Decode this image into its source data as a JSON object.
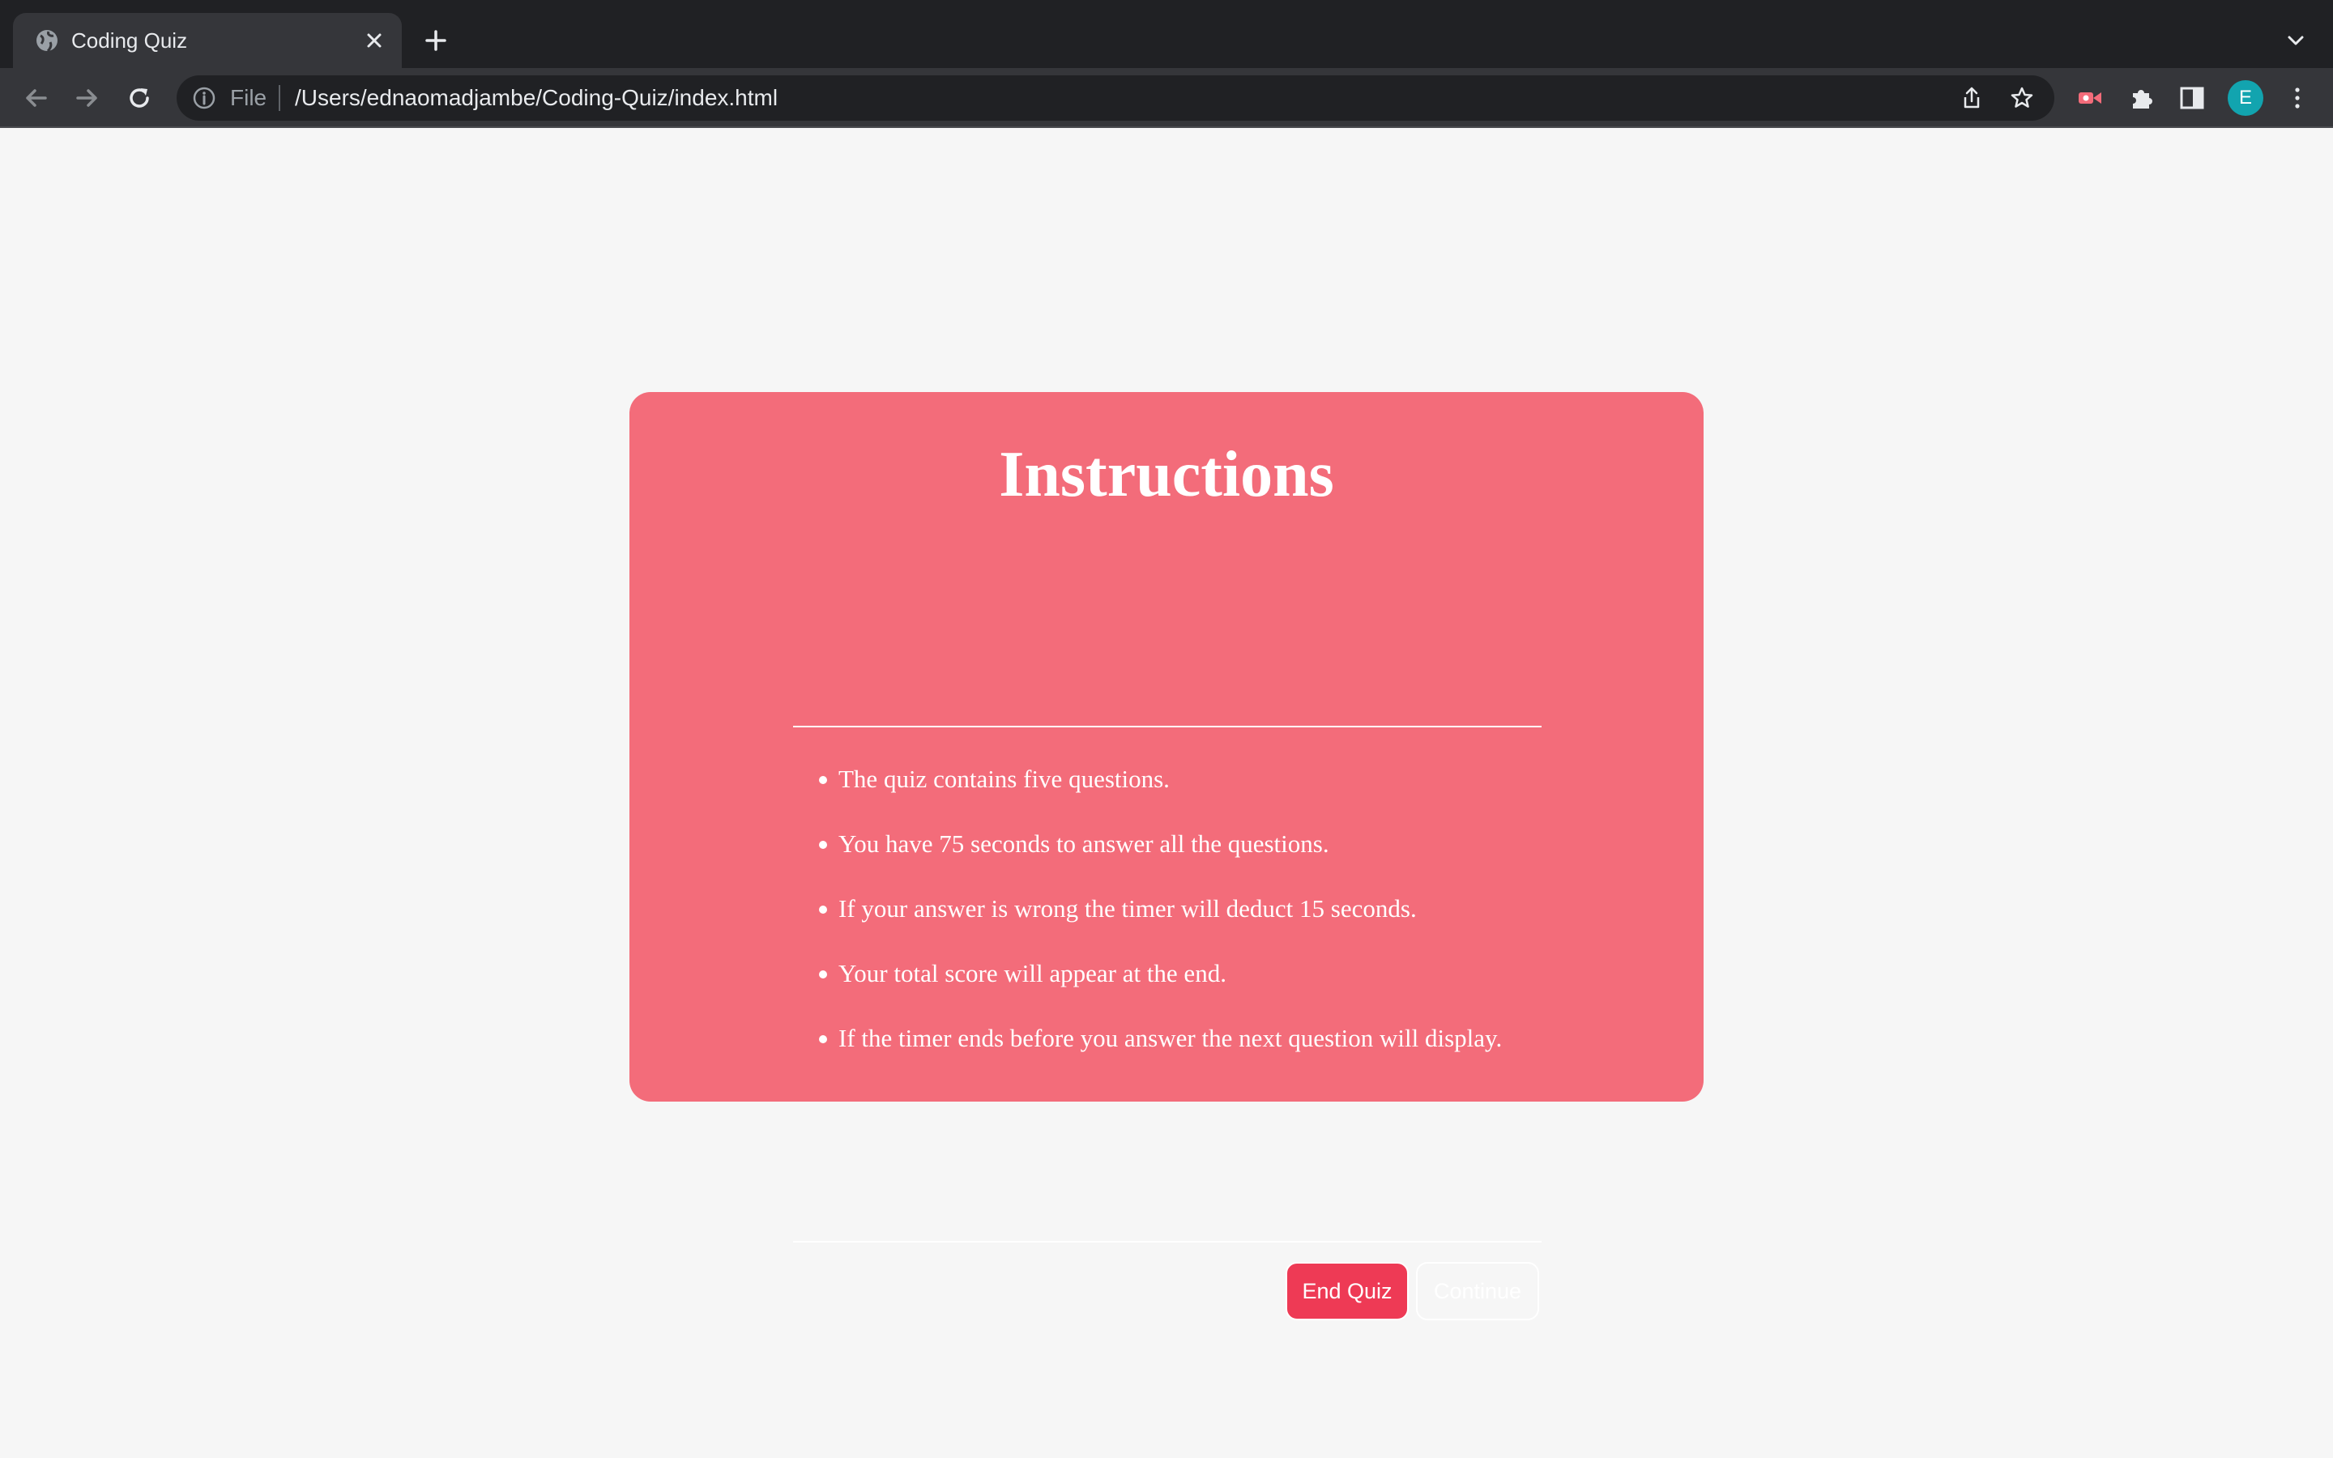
{
  "browser": {
    "tab": {
      "title": "Coding Quiz",
      "favicon": "globe-icon",
      "close_icon": "close-icon"
    },
    "new_tab_icon": "plus-icon",
    "tab_search_icon": "chevron-down-icon",
    "toolbar": {
      "back_icon": "arrow-left-icon",
      "forward_icon": "arrow-right-icon",
      "reload_icon": "reload-icon",
      "omnibox": {
        "info_icon": "info-icon",
        "scheme_label": "File",
        "url": "/Users/ednaomadjambe/Coding-Quiz/index.html",
        "share_icon": "share-icon",
        "bookmark_icon": "star-icon"
      },
      "extension_icon": "extension-puzzle-icon",
      "side_panel_icon": "side-panel-icon",
      "profile_initial": "E",
      "menu_icon": "kebab-menu-icon",
      "colors": {
        "avatar": "#12a4af",
        "recorder_extension": "#f36c7a"
      }
    }
  },
  "page": {
    "background": "#f6f6f6",
    "card": {
      "title": "Instructions",
      "background": "#f36c7a",
      "items": [
        "The quiz contains five questions.",
        "You have 75 seconds to answer all the questions.",
        "If your answer is wrong the timer will deduct 15 seconds.",
        "Your total score will appear at the end.",
        "If the timer ends before you answer the next question will display."
      ],
      "buttons": {
        "end_quiz": "End Quiz",
        "continue": "Continue"
      },
      "button_accent": "#ee3a55"
    }
  }
}
